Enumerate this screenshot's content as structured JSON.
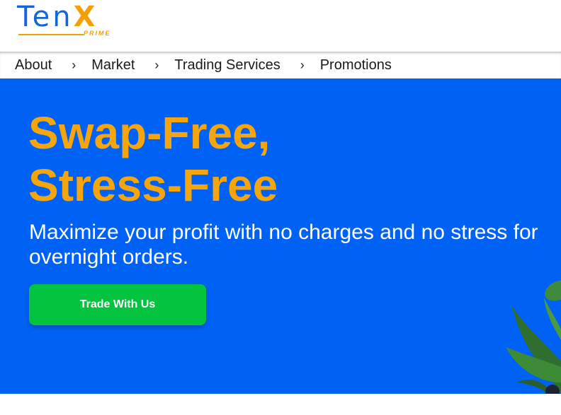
{
  "brand": {
    "name_main": "Ten",
    "name_accent": "X",
    "name_sub": "PRIME",
    "primary_color": "#1565d8",
    "accent_color": "#f5a000"
  },
  "nav": {
    "items": [
      {
        "label": "About"
      },
      {
        "label": "Market"
      },
      {
        "label": "Trading Services"
      },
      {
        "label": "Promotions"
      }
    ],
    "separator": "›"
  },
  "hero": {
    "background_color": "#0062f5",
    "headline_line1": "Swap-Free,",
    "headline_line2": "Stress-Free",
    "headline_color": "#f7a50d",
    "subheadline": "Maximize your profit with no charges and no stress for overnight orders.",
    "cta_label": "Trade With Us",
    "cta_color": "#04c33e",
    "decoration_icon": "leaf-plant-icon"
  }
}
